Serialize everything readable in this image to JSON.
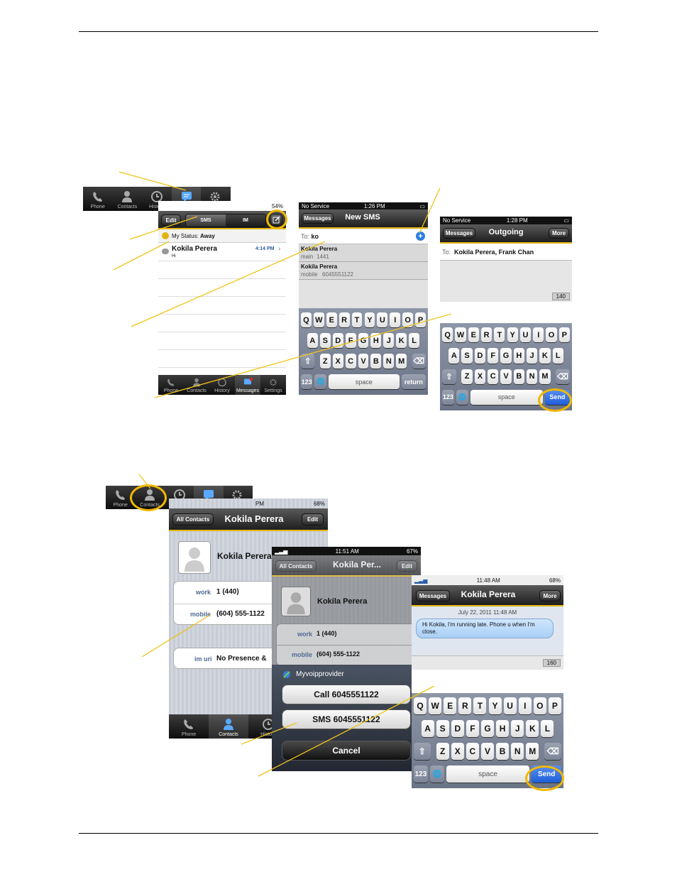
{
  "tabs": {
    "phone": "Phone",
    "contacts": "Contacts",
    "history": "History",
    "im": "IM",
    "settings": "Settings",
    "messages": "Messages"
  },
  "status": {
    "battery1": "54%",
    "noservice": "No Service",
    "time1": "1:26 PM",
    "time2": "1:28 PM",
    "battery2": "68%",
    "time3": "11:51 AM",
    "battery3": "67%",
    "time4": "11:48 AM",
    "battery4": "68%",
    "pm": "PM"
  },
  "im_screen": {
    "edit": "Edit",
    "seg_sms": "SMS",
    "seg_im": "IM",
    "my_status_label": "My Status:",
    "my_status_value": "Away",
    "contact_name": "Kokila Perera",
    "contact_msg": "Hi",
    "contact_time": "4:14 PM"
  },
  "new_sms": {
    "back": "Messages",
    "title": "New SMS",
    "to_label": "To:",
    "to_value": "ko",
    "suggestions": [
      {
        "name": "Kokila Perera",
        "type": "main",
        "number": "1441"
      },
      {
        "name": "Kokila Perera",
        "type": "mobile",
        "number": "6045551122"
      }
    ]
  },
  "outgoing": {
    "back": "Messages",
    "title": "Outgoing",
    "more": "More",
    "to_label": "To:",
    "to_value": "Kokila Perera, Frank Chan",
    "counter": "140"
  },
  "keyboard": {
    "row1": [
      "Q",
      "W",
      "E",
      "R",
      "T",
      "Y",
      "U",
      "I",
      "O",
      "P"
    ],
    "row2": [
      "A",
      "S",
      "D",
      "F",
      "G",
      "H",
      "J",
      "K",
      "L"
    ],
    "row3": [
      "Z",
      "X",
      "C",
      "V",
      "B",
      "N",
      "M"
    ],
    "num": "123",
    "space": "space",
    "return": "return",
    "send": "Send",
    "shift": "⇧",
    "del": "⌫",
    "globe": "🌐"
  },
  "contact_screen": {
    "back": "All Contacts",
    "title": "Kokila Perera",
    "edit": "Edit",
    "name": "Kokila Perera",
    "work_label": "work",
    "work_value": "1 (440)",
    "mobile_label": "mobile",
    "mobile_value": "(604) 555-1122",
    "imuri_label": "im uri",
    "imuri_value": "No Presence &"
  },
  "contact_screen2": {
    "back": "All Contacts",
    "title": "Kokila Per...",
    "edit": "Edit",
    "name": "Kokila Perera",
    "work_label": "work",
    "work_value": "1 (440)",
    "mobile_label": "mobile",
    "mobile_value": "(604) 555-1122"
  },
  "action_sheet": {
    "provider": "Myvoipprovider",
    "call": "Call 6045551122",
    "sms": "SMS 6045551122",
    "cancel": "Cancel"
  },
  "sms_convo": {
    "back": "Messages",
    "title": "Kokila Perera",
    "more": "More",
    "date": "July 22, 2011 11:48 AM",
    "message": "Hi Kokila, I'm running late. Phone u when I'm close.",
    "counter": "160"
  }
}
